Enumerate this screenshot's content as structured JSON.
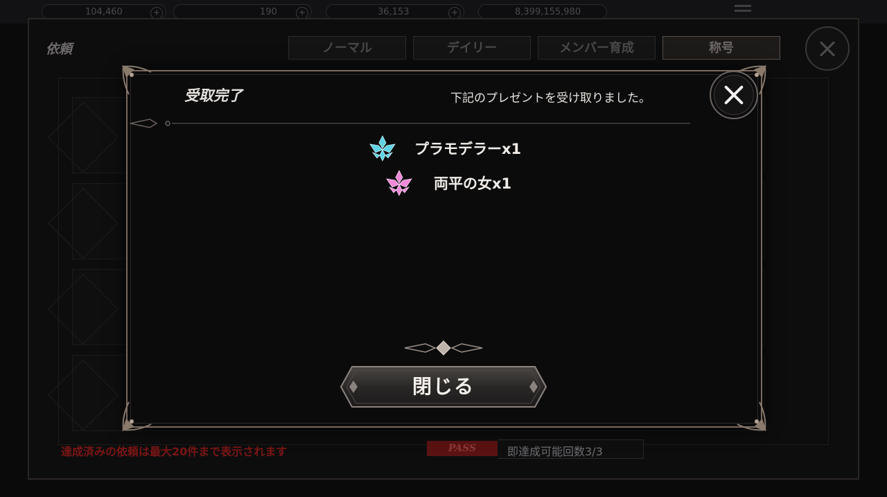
{
  "background": {
    "resources": [
      {
        "value": "104,460",
        "icon": "gem-icon"
      },
      {
        "value": "190",
        "icon": "stamina-icon"
      },
      {
        "value": "36,153",
        "icon": "coin-icon"
      },
      {
        "value": "8,399,155,980",
        "icon": "orb-icon"
      }
    ],
    "window_title": "依頼",
    "tabs": [
      "ノーマル",
      "デイリー",
      "メンバー育成",
      "称号"
    ],
    "active_tab": "称号",
    "notice": "達成済みの依頼は最大20件まで表示されます",
    "pass_badge": "PASS",
    "instant_count": "即達成可能回数3/3"
  },
  "dialog": {
    "title": "受取完了",
    "message": "下記のプレゼントを受け取りました。",
    "rewards": [
      {
        "name": "プラモデラーx1",
        "icon": "cyan-emblem-icon",
        "color": "#5fd4e6"
      },
      {
        "name": "両平の女x1",
        "icon": "pink-emblem-icon",
        "color": "#f08ad8"
      }
    ],
    "close_button_label": "閉じる"
  },
  "colors": {
    "frame": "#7a6a5f",
    "notice_red": "#7a1615",
    "pass_red": "#5a1212"
  }
}
